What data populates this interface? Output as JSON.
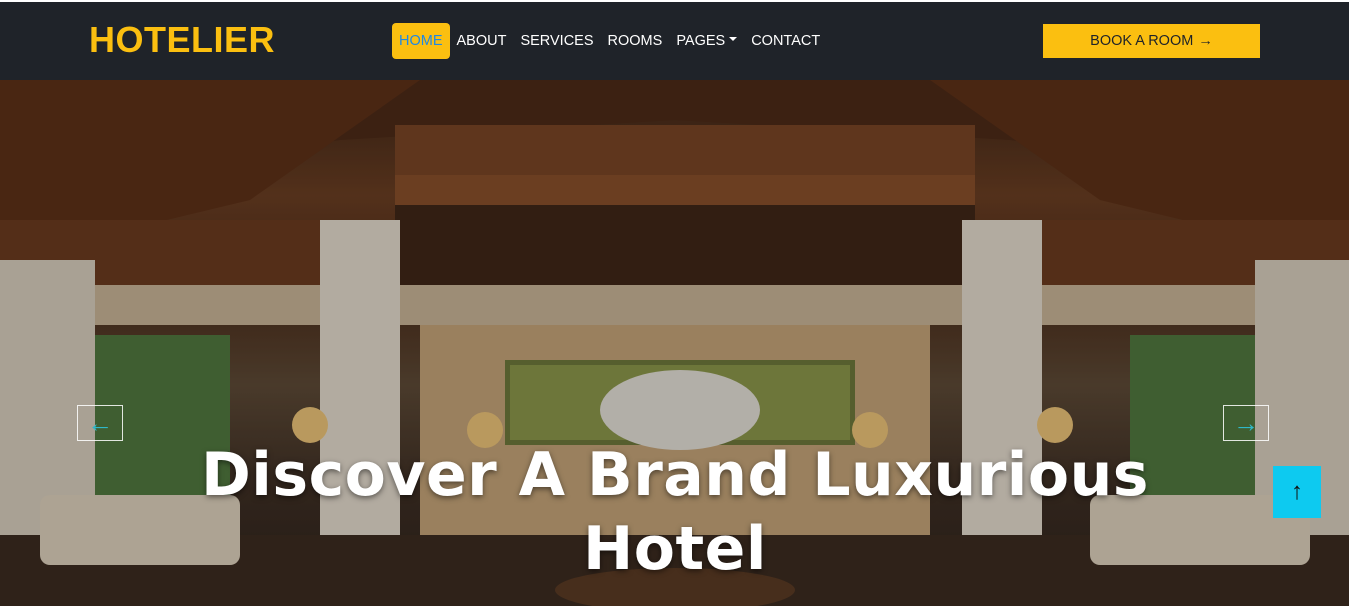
{
  "brand": {
    "name": "HOTELIER",
    "color": "#fbbf10"
  },
  "nav": {
    "items": [
      {
        "label": "HOME",
        "active": true
      },
      {
        "label": "ABOUT"
      },
      {
        "label": "SERVICES"
      },
      {
        "label": "ROOMS"
      },
      {
        "label": "PAGES",
        "dropdown": true
      },
      {
        "label": "CONTACT"
      }
    ],
    "active_bg": "#fbbf10",
    "active_text": "#1e88e5"
  },
  "book_button": {
    "label": "BOOK A ROOM",
    "icon": "arrow-right-icon",
    "color": "#fbbf10"
  },
  "hero": {
    "title": "Discover A Brand Luxurious Hotel",
    "prev_icon": "arrow-left-icon",
    "next_icon": "arrow-right-icon"
  },
  "back_to_top": {
    "icon": "arrow-up-icon",
    "color": "#0dcaf0"
  }
}
